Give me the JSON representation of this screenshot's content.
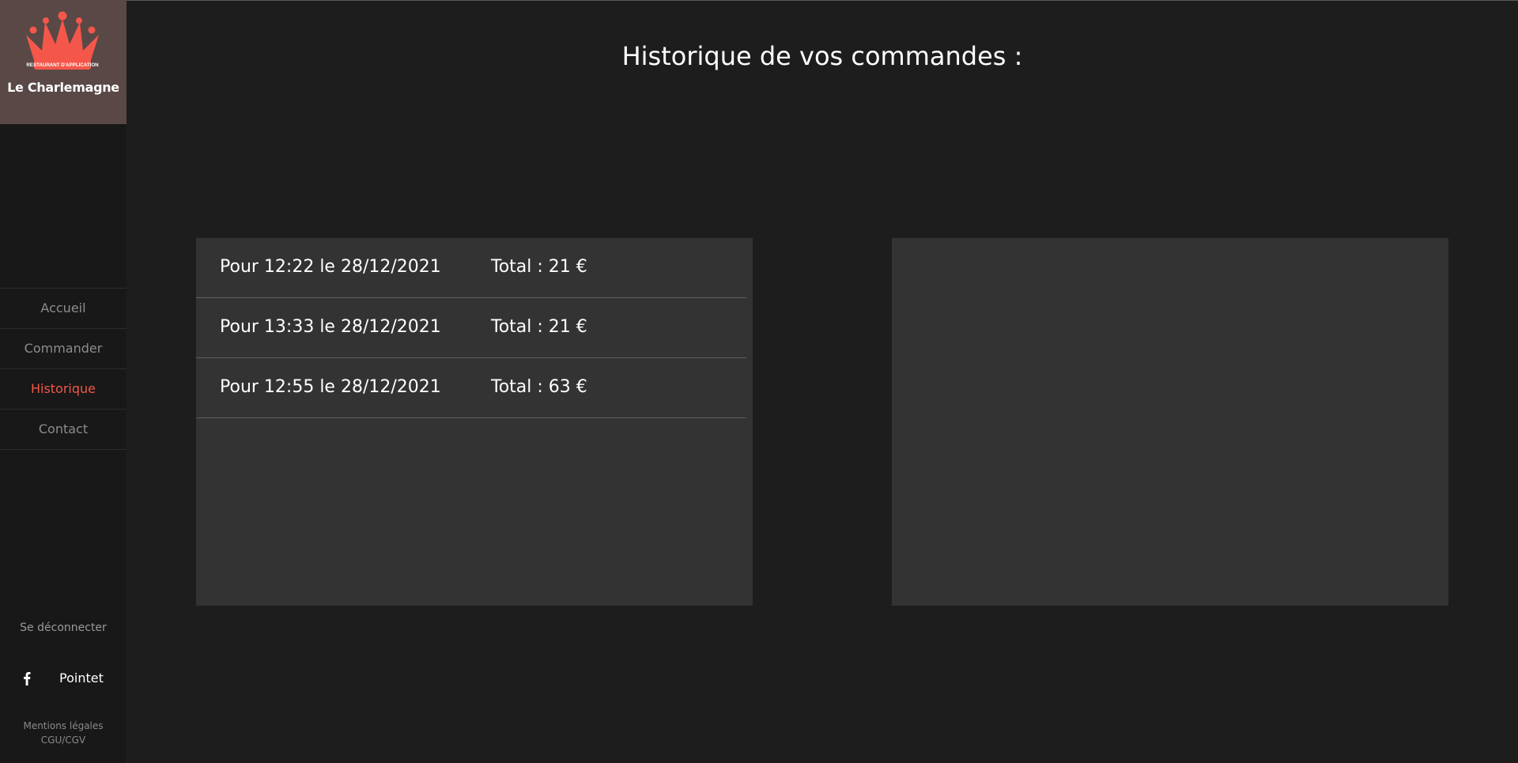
{
  "colors": {
    "background": "#1d1d1d",
    "sidebar": "#181818",
    "logo_background": "#594846",
    "accent": "#f0584a",
    "panel": "#333333"
  },
  "sidebar": {
    "logo": {
      "badge_text": "RESTAURANT D'APPLICATION",
      "brand_name": "Le Charlemagne",
      "icon": "crown-icon"
    },
    "nav": [
      {
        "label": "Accueil",
        "active": false
      },
      {
        "label": "Commander",
        "active": false
      },
      {
        "label": "Historique",
        "active": true
      },
      {
        "label": "Contact",
        "active": false
      }
    ],
    "logout_label": "Se déconnecter",
    "social": {
      "icon": "facebook-icon",
      "label": "Pointet"
    },
    "legal": {
      "mentions": "Mentions légales",
      "cgu": "CGU/CGV"
    }
  },
  "main": {
    "title": "Historique de vos commandes :",
    "orders": [
      {
        "when": "Pour 12:22 le 28/12/2021",
        "total": "Total : 21 €"
      },
      {
        "when": "Pour 13:33 le 28/12/2021",
        "total": "Total : 21 €"
      },
      {
        "when": "Pour 12:55 le 28/12/2021",
        "total": "Total : 63 €"
      }
    ]
  }
}
